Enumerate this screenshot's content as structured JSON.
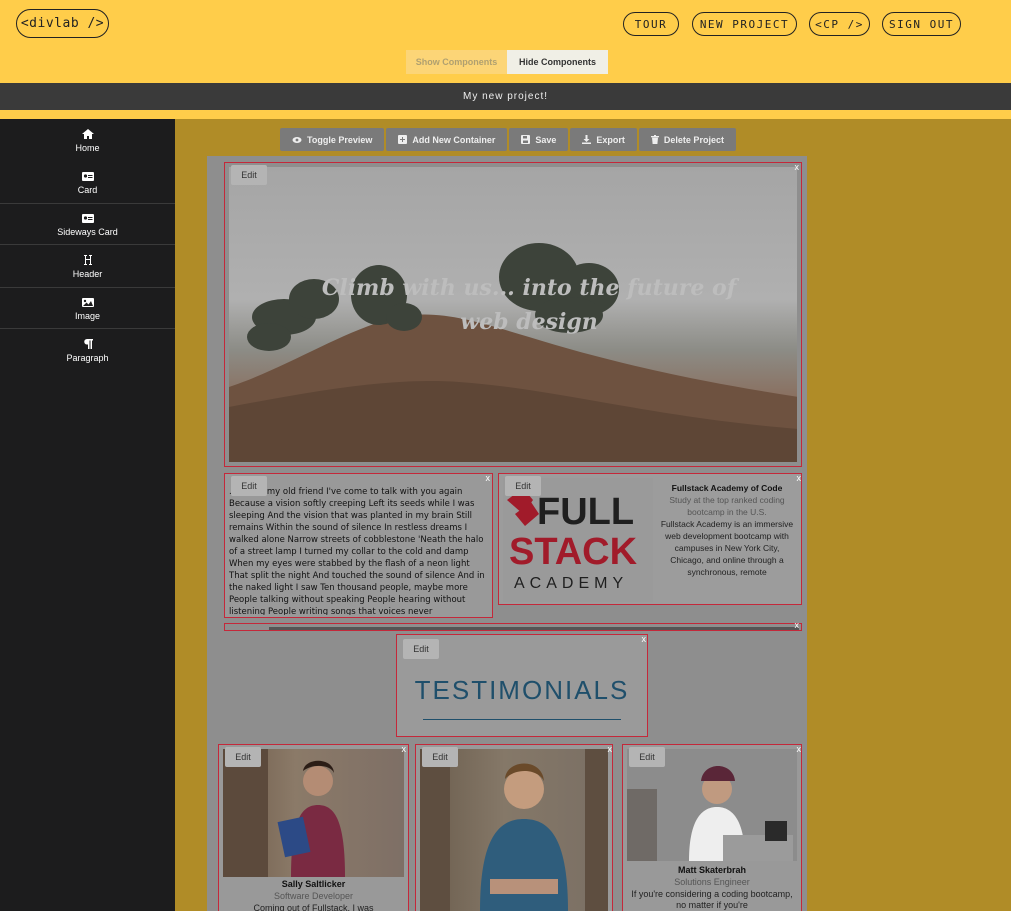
{
  "header": {
    "logo": "<divlab />",
    "nav": [
      "TOUR",
      "NEW PROJECT",
      "<CP />",
      "SIGN OUT"
    ],
    "toggle": {
      "show": "Show Components",
      "hide": "Hide Components"
    }
  },
  "project": {
    "name": "My new project!"
  },
  "sidebar": {
    "items": [
      {
        "label": "Home",
        "icon": "home-icon"
      },
      {
        "label": "Card",
        "icon": "id-card-icon"
      },
      {
        "label": "Sideways Card",
        "icon": "id-card-icon"
      },
      {
        "label": "Header",
        "icon": "heading-icon"
      },
      {
        "label": "Image",
        "icon": "image-icon"
      },
      {
        "label": "Paragraph",
        "icon": "paragraph-icon"
      }
    ]
  },
  "toolbar": {
    "buttons": [
      {
        "label": "Toggle Preview",
        "icon": "eye-icon"
      },
      {
        "label": "Add New Container",
        "icon": "plus-square-icon"
      },
      {
        "label": "Save",
        "icon": "save-icon"
      },
      {
        "label": "Export",
        "icon": "download-icon"
      },
      {
        "label": "Delete Project",
        "icon": "trash-icon"
      }
    ]
  },
  "canvas": {
    "edit_label": "Edit",
    "close_label": "x",
    "hero": {
      "text": "Climb with us... into the future of web design"
    },
    "paragraph": {
      "text": "...kness, my old friend I've come to talk with you again Because a vision softly creeping Left its seeds while I was sleeping And the vision that was planted in my brain Still remains Within the sound of silence In restless dreams I walked alone Narrow streets of cobblestone 'Neath the halo of a street lamp I turned my collar to the cold and damp When my eyes were stabbed by the flash of a neon light That split the night And touched the sound of silence And in the naked light I saw Ten thousand people, maybe more People talking without speaking People hearing without listening People writing songs that voices never"
    },
    "sideways_card": {
      "logo_line1": "FULL",
      "logo_line2": "STACK",
      "logo_line3": "ACADEMY",
      "title": "Fullstack Academy of Code",
      "subtitle": "Study at the top ranked coding bootcamp in the U.S.",
      "body": "Fullstack Academy is an immersive web development bootcamp with campuses in New York City, Chicago, and online through a synchronous, remote"
    },
    "header_block": {
      "text": "TESTIMONIALS"
    },
    "cards": [
      {
        "name": "Sally Saltlicker",
        "role": "Software Developer",
        "desc": "Coming out of Fullstack, I was"
      },
      {
        "name": "",
        "role": "",
        "desc": ""
      },
      {
        "name": "Matt Skaterbrah",
        "role": "Solutions Engineer",
        "desc": "If you're considering a coding bootcamp, no matter if you're"
      }
    ]
  }
}
